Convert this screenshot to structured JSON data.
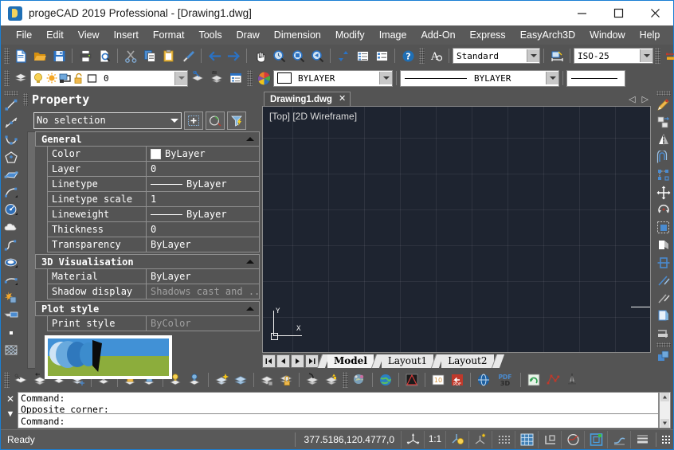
{
  "window": {
    "title": "progeCAD 2019 Professional - [Drawing1.dwg]",
    "app_icon": "progecad-logo-icon",
    "minimize_label": "–",
    "maximize_label": "□",
    "close_label": "✕"
  },
  "menubar": {
    "items": [
      {
        "label": "File"
      },
      {
        "label": "Edit"
      },
      {
        "label": "View"
      },
      {
        "label": "Insert"
      },
      {
        "label": "Format"
      },
      {
        "label": "Tools"
      },
      {
        "label": "Draw"
      },
      {
        "label": "Dimension"
      },
      {
        "label": "Modify"
      },
      {
        "label": "Image"
      },
      {
        "label": "Add-On"
      },
      {
        "label": "Express"
      },
      {
        "label": "EasyArch3D"
      },
      {
        "label": "Window"
      },
      {
        "label": "Help"
      }
    ]
  },
  "toolbar_standard": {
    "icons": [
      "new-file-icon",
      "open-folder-icon",
      "save-icon",
      "print-icon",
      "print-preview-icon",
      "cut-scissors-icon",
      "copy-icon",
      "paste-icon",
      "match-properties-brush-icon",
      "undo-arrow-icon",
      "redo-arrow-icon",
      "pan-hand-icon",
      "zoom-realtime-icon",
      "zoom-window-icon",
      "zoom-previous-icon",
      "sync-updown-icon",
      "properties-list-icon",
      "block-list-icon",
      "help-question-icon",
      "text-style-icon"
    ],
    "text_style": "Standard",
    "dim-style-icon": "dimension-style-icon",
    "dim_style": "ISO-25",
    "multileader-icon": "multileader-style-icon",
    "table-style-icon": "table-style-icon"
  },
  "toolbar_layer": {
    "layer_tools_icon": "layer-tools-icon",
    "layer_icons": [
      "layer-on-bulb-icon",
      "layer-freeze-sun-icon",
      "layer-current-vp-icon",
      "layer-unlock-icon",
      "layer-color-swatch-icon"
    ],
    "current_layer": "0",
    "make_current_icon": "make-object-layer-current-icon",
    "layer_previous_icon": "layer-previous-icon",
    "layer_states_icon": "layer-states-manager-icon",
    "color_wheel_icon": "color-wheel-icon",
    "color_value": "BYLAYER",
    "linetype_value": "BYLAYER",
    "lineweight_value": ""
  },
  "property_panel": {
    "title": "Property",
    "selection": "No selection",
    "buttons": [
      "quick-select-icon",
      "select-objects-icon",
      "pick-filter-icon"
    ],
    "groups": [
      {
        "name": "General",
        "rows": [
          {
            "key": "Color",
            "value": "ByLayer",
            "type": "color"
          },
          {
            "key": "Layer",
            "value": "0",
            "type": "text"
          },
          {
            "key": "Linetype",
            "value": "ByLayer",
            "type": "line"
          },
          {
            "key": "Linetype scale",
            "value": "1",
            "type": "text"
          },
          {
            "key": "Lineweight",
            "value": "ByLayer",
            "type": "line"
          },
          {
            "key": "Thickness",
            "value": "0",
            "type": "text"
          },
          {
            "key": "Transparency",
            "value": "ByLayer",
            "type": "text"
          }
        ]
      },
      {
        "name": "3D Visualisation",
        "rows": [
          {
            "key": "Material",
            "value": "ByLayer",
            "type": "text"
          },
          {
            "key": "Shadow display",
            "value": "Shadows cast and ...",
            "type": "dim"
          }
        ]
      },
      {
        "name": "Plot style",
        "rows": [
          {
            "key": "Print style",
            "value": "ByColor",
            "type": "dim"
          }
        ]
      }
    ]
  },
  "image_preview": {
    "name": "image-thumbnail-preview",
    "description": "landscape raster image thumbnail"
  },
  "document_tabs": {
    "tabs": [
      {
        "label": "Drawing1.dwg",
        "close": "✕",
        "active": true
      }
    ],
    "nav_prev": "◁",
    "nav_next": "▷"
  },
  "canvas": {
    "view_label": "[Top] [2D Wireframe]",
    "ucs_x": "X",
    "ucs_y": "Y",
    "background": "#1e2430",
    "crosshair_color": "#f2f2f2"
  },
  "layout_tabs": {
    "nav": [
      "first-layout-icon",
      "prev-layout-icon",
      "next-layout-icon",
      "last-layout-icon"
    ],
    "tabs": [
      {
        "label": "Model",
        "active": true
      },
      {
        "label": "Layout1",
        "active": false
      },
      {
        "label": "Layout2",
        "active": false
      }
    ]
  },
  "command_line": {
    "close_icon": "✕",
    "expand_icon": "▼",
    "history": [
      "Command:",
      "Opposite corner:"
    ],
    "prompt": "Command:"
  },
  "statusbar": {
    "ready": "Ready",
    "coordinates": "377.5186,120.4777,0",
    "scale": "1:1",
    "cells": [
      "ucs-icon",
      "annotation-scale-icon",
      "lightbulb-ucs-icon",
      "dynamic-ucs-icon",
      "snap-dots-icon",
      "grid-icon",
      "ortho-icon",
      "polar-tracking-icon",
      "object-snap-icon",
      "otrack-icon",
      "lineweight-icon"
    ],
    "resize_grip": "resize-grip-icon"
  },
  "bottom_toolbar": {
    "icons": [
      "layer-tools-icon",
      "layer-previous-icon",
      "layer-freeze-icon",
      "layer-isolate-icon",
      "layer-off-icon",
      "layer-lock-icon",
      "layer-unlock-icon",
      "layer-on-icon",
      "layer-thaw-icon",
      "layer-merge-icon",
      "layer-delete-icon",
      "layer-walk-icon",
      "layer-save-icon",
      "layer-lock-fade-icon",
      "layer-match-icon",
      "layer-change-icon",
      "render-icon",
      "globe-icon",
      "clip-image-icon",
      "image-frame-icon",
      "pdf-export-icon",
      "web-icon",
      "pdf3d-icon",
      "refresh-icon",
      "polyline-edit-icon",
      "measure-icon"
    ]
  },
  "left_toolbar": {
    "icons": [
      "line-icon",
      "construction-line-icon",
      "polyline-icon",
      "polygon-icon",
      "rectangle-icon",
      "arc-icon",
      "circle-icon",
      "cloud-icon",
      "spline-icon",
      "ellipse-icon",
      "elliptical-arc-icon",
      "insert-block-icon",
      "make-block-icon",
      "point-icon",
      "hatch-icon"
    ]
  },
  "right_toolbar": {
    "icons": [
      "erase-icon",
      "copy-object-icon",
      "mirror-icon",
      "offset-icon",
      "array-icon",
      "move-icon",
      "rotate-icon",
      "scale-icon",
      "stretch-icon",
      "trim-icon",
      "extend-icon",
      "break-icon",
      "chamfer-icon",
      "fillet-icon",
      "explode-icon"
    ]
  }
}
